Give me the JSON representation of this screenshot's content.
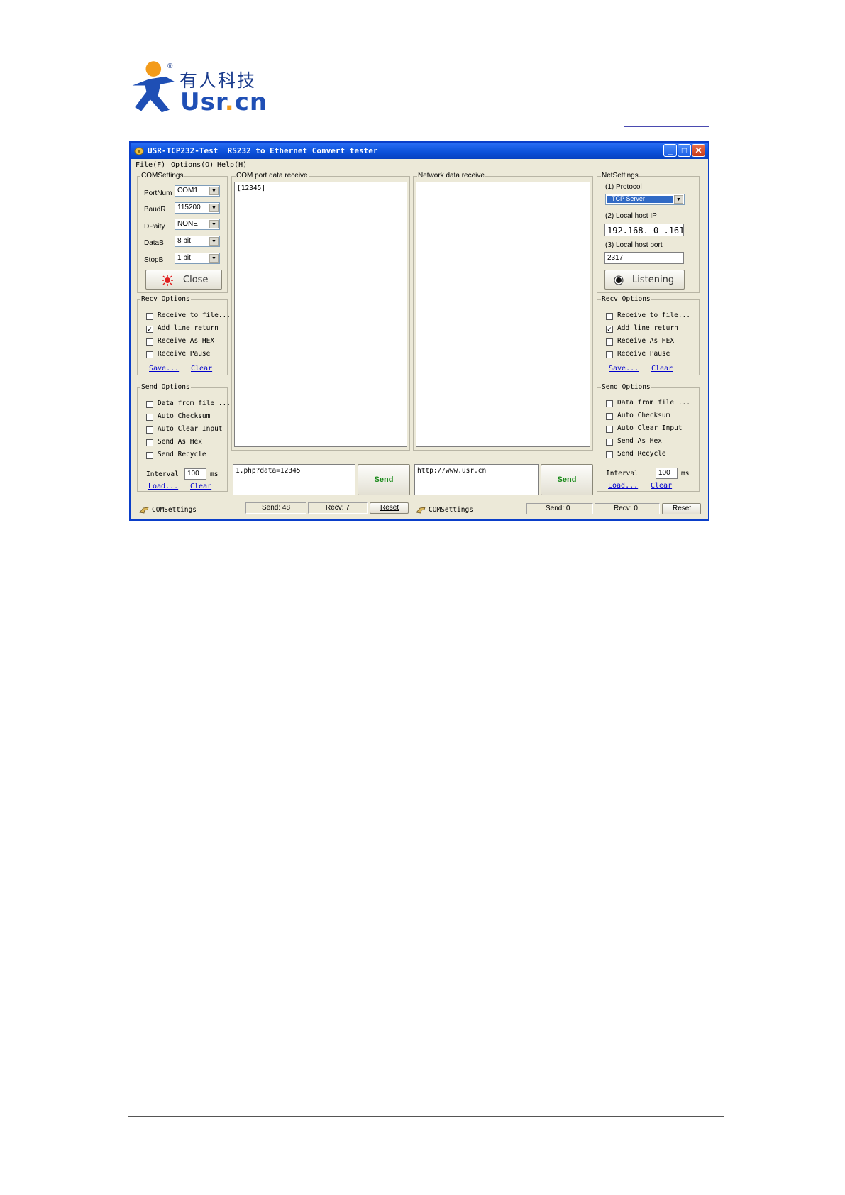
{
  "logo": {
    "cn": "有人科技",
    "en_a": "Usr",
    "en_dot": ".",
    "en_b": "cn",
    "registered": "®"
  },
  "window": {
    "title": "USR-TCP232-Test  RS232 to Ethernet Convert tester",
    "menu": [
      "File(F)",
      "Options(O)",
      "Help(H)"
    ],
    "com_settings": {
      "label": "COMSettings",
      "fields": [
        {
          "label": "PortNum",
          "value": "COM1"
        },
        {
          "label": "BaudR",
          "value": "115200"
        },
        {
          "label": "DPaity",
          "value": "NONE"
        },
        {
          "label": "DataB",
          "value": "8 bit"
        },
        {
          "label": "StopB",
          "value": "1 bit"
        }
      ],
      "close_button": "Close"
    },
    "recv_options_left": {
      "label": "Recv Options",
      "items": [
        "Receive to file...",
        "Add line return",
        "Receive As HEX",
        "Receive Pause"
      ],
      "save": "Save...",
      "clear": "Clear"
    },
    "send_options_left": {
      "label": "Send Options",
      "items": [
        "Data from file ...",
        "Auto Checksum",
        "Auto Clear Input",
        "Send As Hex",
        "Send Recycle"
      ],
      "interval_label": "Interval",
      "interval_value": "100",
      "interval_unit": "ms",
      "load": "Load...",
      "clear": "Clear"
    },
    "com_receive": {
      "label": "COM port data receive",
      "content": "[12345]"
    },
    "net_receive": {
      "label": "Network data receive",
      "content": ""
    },
    "com_send": {
      "input": "1.php?data=12345",
      "button": "Send"
    },
    "net_send": {
      "input": "http://www.usr.cn",
      "button": "Send"
    },
    "net_settings": {
      "label": "NetSettings",
      "protocol_label": "(1) Protocol",
      "protocol_value": "TCP Server",
      "ip_label": "(2) Local host IP",
      "ip_value": "192.168. 0 .161",
      "port_label": "(3) Local host port",
      "port_value": "2317",
      "listen_button": "Listening"
    },
    "recv_options_right": {
      "label": "Recv Options",
      "items": [
        "Receive to file...",
        "Add line return",
        "Receive As HEX",
        "Receive Pause"
      ],
      "save": "Save...",
      "clear": "Clear"
    },
    "send_options_right": {
      "label": "Send Options",
      "items": [
        "Data from file ...",
        "Auto Checksum",
        "Auto Clear Input",
        "Send As Hex",
        "Send Recycle"
      ],
      "interval_label": "Interval",
      "interval_value": "100",
      "interval_unit": "ms",
      "load": "Load...",
      "clear": "Clear"
    },
    "status_left": {
      "settings": "COMSettings",
      "send": "Send: 48",
      "recv": "Recv: 7",
      "reset": "Reset"
    },
    "status_right": {
      "settings": "COMSettings",
      "send": "Send: 0",
      "recv": "Recv: 0",
      "reset": "Reset"
    }
  },
  "colors": {
    "title_bar": "#0a4fd8",
    "send_text": "#1a8a1a",
    "link": "#0000cc",
    "close_icon": "#e02020"
  }
}
